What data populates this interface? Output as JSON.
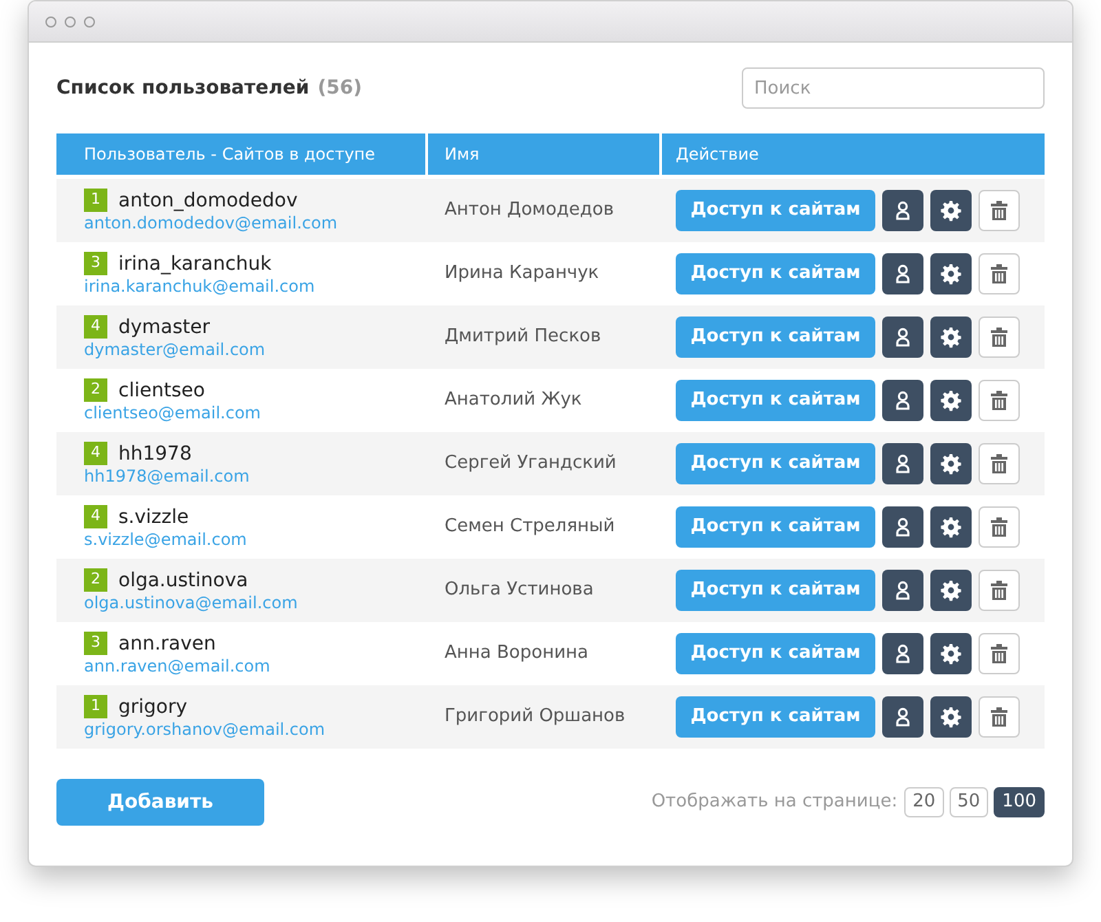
{
  "title": "Список пользователей",
  "count": "(56)",
  "search": {
    "placeholder": "Поиск"
  },
  "columns": [
    "Пользователь - Сайтов в доступе",
    "Имя",
    "Действие"
  ],
  "rows": [
    {
      "sites": "1",
      "login": "anton_domodedov",
      "email": "anton.domodedov@email.com",
      "name": "Антон Домодедов",
      "action": "Доступ к сайтам"
    },
    {
      "sites": "3",
      "login": "irina_karanchuk",
      "email": "irina.karanchuk@email.com",
      "name": "Ирина Каранчук",
      "action": "Доступ к сайтам"
    },
    {
      "sites": "4",
      "login": "dymaster",
      "email": "dymaster@email.com",
      "name": "Дмитрий Песков",
      "action": "Доступ к сайтам"
    },
    {
      "sites": "2",
      "login": "clientseo",
      "email": "clientseo@email.com",
      "name": "Анатолий Жук",
      "action": "Доступ к сайтам"
    },
    {
      "sites": "4",
      "login": "hh1978",
      "email": "hh1978@email.com",
      "name": "Сергей Угандский",
      "action": "Доступ к сайтам"
    },
    {
      "sites": "4",
      "login": "s.vizzle",
      "email": "s.vizzle@email.com",
      "name": "Семен Стреляный",
      "action": "Доступ к сайтам"
    },
    {
      "sites": "2",
      "login": "olga.ustinova",
      "email": "olga.ustinova@email.com",
      "name": "Ольга Устинова",
      "action": "Доступ к сайтам"
    },
    {
      "sites": "3",
      "login": "ann.raven",
      "email": "ann.raven@email.com",
      "name": "Анна Воронина",
      "action": "Доступ к сайтам"
    },
    {
      "sites": "1",
      "login": "grigory",
      "email": "grigory.orshanov@email.com",
      "name": "Григорий Оршанов",
      "action": "Доступ к сайтам"
    }
  ],
  "add_button": "Добавить",
  "per_page": {
    "label": "Отображать на странице:",
    "options": [
      {
        "label": "20",
        "selected": false
      },
      {
        "label": "50",
        "selected": false
      },
      {
        "label": "100",
        "selected": true
      }
    ]
  }
}
